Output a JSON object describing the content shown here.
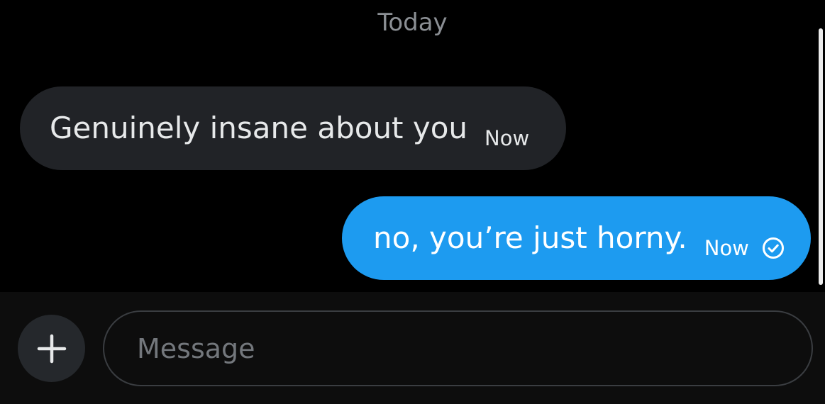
{
  "conversation": {
    "date_separator": "Today",
    "messages": [
      {
        "direction": "received",
        "text": "Genuinely insane about you",
        "time": "Now"
      },
      {
        "direction": "sent",
        "text": "no, you’re just horny.",
        "time": "Now",
        "status_icon": "check-circle-icon"
      }
    ]
  },
  "composer": {
    "add_icon": "plus-icon",
    "placeholder": "Message"
  },
  "colors": {
    "background": "#000000",
    "received_bubble": "#212327",
    "sent_bubble": "#1d9bf0",
    "composer_bar": "#0d0d0d",
    "muted_text": "#8b8f94"
  }
}
